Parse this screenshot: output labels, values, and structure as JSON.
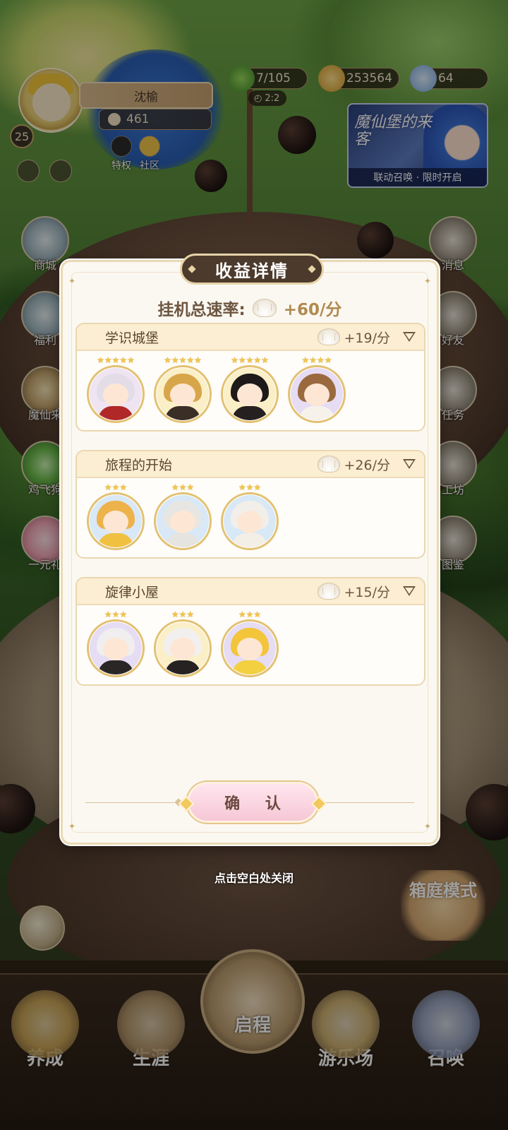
{
  "player": {
    "name": "沈榆",
    "level": "25",
    "power": "461",
    "privilege_label": "特权",
    "community_label": "社区"
  },
  "resources": {
    "clover": "7/105",
    "timer": "2:2",
    "coins": "253564",
    "gems": "64"
  },
  "banner": {
    "title": "魔仙堡的来客",
    "caption": "联动召唤 · 限时开启"
  },
  "side_left": [
    "商城",
    "福利",
    "魔仙来",
    "鸡飞狗",
    "一元礼"
  ],
  "side_right": [
    "消息",
    "好友",
    "任务",
    "工坊",
    "图鉴"
  ],
  "modal": {
    "title": "收益详情",
    "total_label": "挂机总速率:",
    "total_value": "+60/分",
    "groups": [
      {
        "name": "学识城堡",
        "rate": "+19/分",
        "stars": [
          "★★★★★",
          "★★★★★",
          "★★★★★",
          "★★★★"
        ]
      },
      {
        "name": "旅程的开始",
        "rate": "+26/分",
        "stars": [
          "★★★",
          "★★★",
          "★★★"
        ]
      },
      {
        "name": "旋律小屋",
        "rate": "+15/分",
        "stars": [
          "★★★",
          "★★★",
          "★★★"
        ]
      }
    ],
    "confirm_label": "确 认",
    "close_hint": "点击空白处关闭"
  },
  "garden_mode": "箱庭模式",
  "nav": {
    "items": [
      "养成",
      "生涯",
      "启程",
      "游乐场",
      "召唤"
    ]
  }
}
